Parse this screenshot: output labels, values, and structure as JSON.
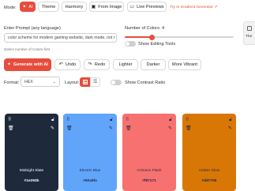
{
  "mode": {
    "label": "Mode:",
    "buttons": [
      {
        "label": "AI",
        "icon": "sparkle-icon",
        "glyph": "✦"
      },
      {
        "label": "Theme",
        "icon": "theme-icon",
        "glyph": ""
      },
      {
        "label": "Harmony",
        "icon": "harmony-icon",
        "glyph": ""
      },
      {
        "label": "From Image",
        "icon": "image-icon",
        "glyph": "▣"
      },
      {
        "label": "Live Previews",
        "icon": "preview-icon",
        "glyph": "▭"
      }
    ],
    "gradient_link": "Try AI Gradient Generator ⇗"
  },
  "side_tab": {
    "label": "The"
  },
  "prompt": {
    "label": "Enter Prompt (any language)",
    "value": "color scheme for modern gaming website, dark mode, not r",
    "hint": "Select number of Colors first"
  },
  "colors_count": {
    "label": "Number of Colors: 4",
    "value": 4,
    "min": 2,
    "max": 10
  },
  "editing_tools": {
    "label": "Show Editing Tools"
  },
  "actions": {
    "generate": "Generate with AI",
    "undo": "Undo",
    "redo": "Redo",
    "lighter": "Lighter",
    "darker": "Darker",
    "more_vibrant": "More Vibrant"
  },
  "format": {
    "label": "Format:",
    "value": "HEX"
  },
  "layout": {
    "label": "Layout:"
  },
  "contrast": {
    "label": "Show Contrast Ratio"
  },
  "palette": [
    {
      "name": "Midnight Slate",
      "hex": "#1e293b",
      "bg": "#1e293b",
      "fg": "#ffffff"
    },
    {
      "name": "Electric Blue",
      "hex": "#60a5fa",
      "bg": "#60a5fa",
      "fg": "#1e293b"
    },
    {
      "name": "Crimson Flash",
      "hex": "#f87171",
      "bg": "#f87171",
      "fg": "#1e293b"
    },
    {
      "name": "Amber Glow",
      "hex": "#d97706",
      "bg": "#d97706",
      "fg": "#1e293b"
    }
  ],
  "colors": {
    "accent": "#e74c3c"
  }
}
